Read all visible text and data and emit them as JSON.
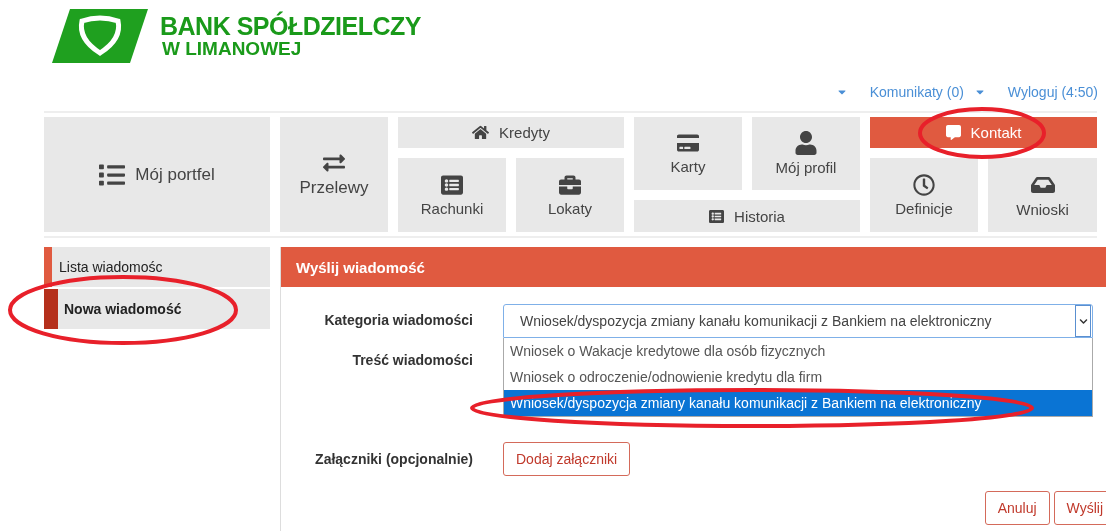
{
  "logo": {
    "line1": "BANK SPÓŁDZIELCZY",
    "line2": "W LIMANOWEJ"
  },
  "top_links": [
    {
      "dropdown": true
    },
    {
      "label": "Komunikaty (0)",
      "dropdown": true
    },
    {
      "label": "Wyloguj (4:50)",
      "dropdown": false
    }
  ],
  "nav": [
    {
      "label": "Mój portfel",
      "selected": false
    },
    {
      "label": "Przelewy",
      "selected": false
    },
    {
      "label": "Kredyty",
      "selected": false
    },
    {
      "label": "Rachunki",
      "selected": false
    },
    {
      "label": "Lokaty",
      "selected": false
    },
    {
      "label": "Karty",
      "selected": false
    },
    {
      "label": "Mój profil",
      "selected": false
    },
    {
      "label": "Historia",
      "selected": false
    },
    {
      "label": "Kontakt",
      "selected": true
    },
    {
      "label": "Definicje",
      "selected": false
    },
    {
      "label": "Wnioski",
      "selected": false
    }
  ],
  "sidebar": {
    "items": [
      {
        "label": "Lista wiadomośc",
        "selected": false
      },
      {
        "label": "Nowa wiadomość",
        "selected": true
      }
    ]
  },
  "panel": {
    "title": "Wyślij wiadomość",
    "category_label": "Kategoria wiadomości",
    "category_value": "Wniosek/dyspozycja zmiany kanału komunikacji z Bankiem na elektroniczny",
    "options": [
      {
        "label": "Wniosek o Wakacje kredytowe dla osób fizycznych",
        "selected": false
      },
      {
        "label": "Wniosek o odroczenie/odnowienie kredytu dla firm",
        "selected": false
      },
      {
        "label": "Wniosek/dyspozycja zmiany kanału komunikacji z Bankiem na elektroniczny",
        "selected": true
      }
    ],
    "content_label": "Treść wiadomości",
    "attachments_label": "Załączniki (opcjonalnie)",
    "attach_button": "Dodaj załączniki",
    "buttons": [
      "Anuluj",
      "Wyślij"
    ]
  },
  "highlights": [
    {
      "kind": "ellipse"
    },
    {
      "kind": "ellipse"
    },
    {
      "kind": "ellipse"
    }
  ]
}
